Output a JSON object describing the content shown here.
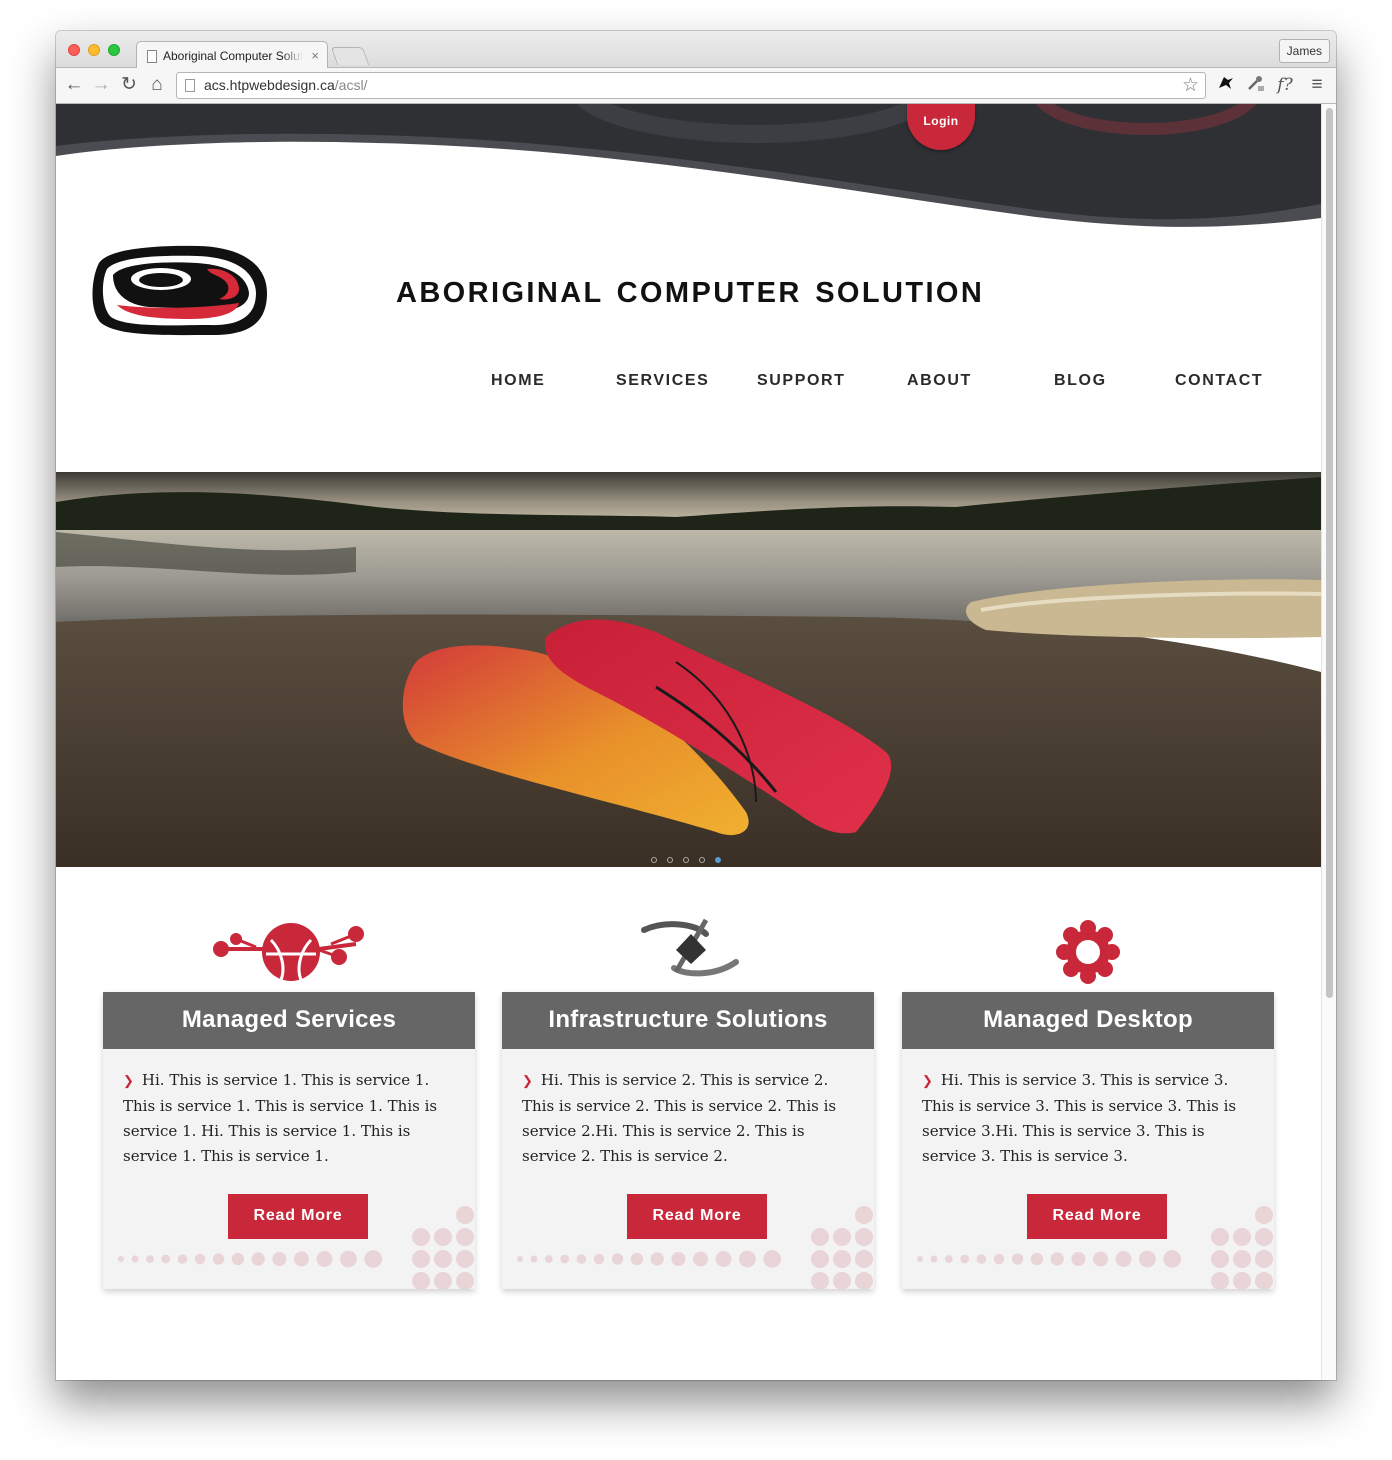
{
  "browser": {
    "tab_title": "Aboriginal Computer Solution",
    "tab_close": "×",
    "profile_name": "James",
    "url_host": "acs.htpwebdesign.ca",
    "url_path": "/acsl/",
    "back_glyph": "←",
    "forward_glyph": "→",
    "reload_glyph": "↻",
    "home_glyph": "⌂",
    "star_glyph": "☆",
    "fx_glyph": "f?",
    "menu_glyph": "≡"
  },
  "header": {
    "login_label": "Login",
    "site_title": "ABORIGINAL COMPUTER SOLUTION"
  },
  "nav": {
    "items": [
      {
        "label": "HOME"
      },
      {
        "label": "SERVICES"
      },
      {
        "label": "SUPPORT"
      },
      {
        "label": "ABOUT"
      },
      {
        "label": "BLOG"
      },
      {
        "label": "CONTACT"
      }
    ]
  },
  "slider": {
    "slide_count": 5,
    "active_index": 4
  },
  "services": [
    {
      "title": "Managed Services",
      "icon": "network-globe-icon",
      "text": "Hi. This is service 1. This is service 1. This is service 1. This is service 1. This is service 1. Hi. This is service 1. This is service 1. This is service 1.",
      "button": "Read More"
    },
    {
      "title": "Infrastructure Solutions",
      "icon": "orbit-diamond-icon",
      "text": "Hi. This is service 2. This is service 2. This is service 2. This is service 2. This is service 2.Hi. This is service 2. This is service 2. This is service 2.",
      "button": "Read More"
    },
    {
      "title": "Managed Desktop",
      "icon": "gear-icon",
      "text": "Hi. This is service 3. This is service 3. This is service 3. This is service 3. This is service 3.Hi. This is service 3. This is service 3. This is service 3.",
      "button": "Read More"
    }
  ],
  "colors": {
    "accent_red": "#c8283a",
    "header_dark": "#2f3135",
    "card_header_gray": "#666666"
  }
}
